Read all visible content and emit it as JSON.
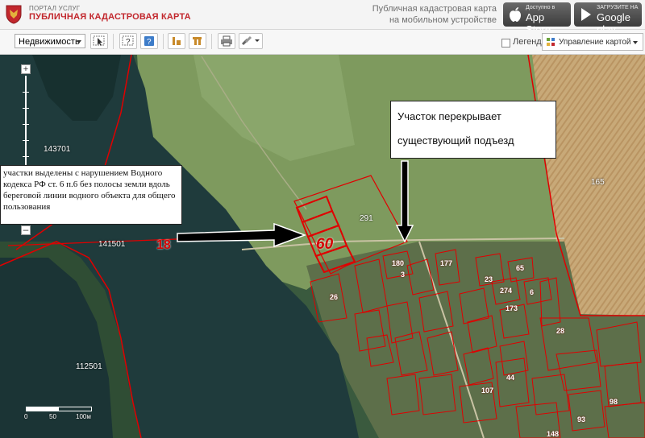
{
  "header": {
    "portal_small": "ПОРТАЛ УСЛУГ",
    "portal_title": "ПУБЛИЧНАЯ КАДАСТРОВАЯ КАРТА",
    "mobile_line1": "Публичная кадастровая карта",
    "mobile_line2": "на мобильном устройстве",
    "appstore_small": "Доступно в",
    "appstore_big": "App Store",
    "googleplay_small": "ЗАГРУЗИТЕ НА",
    "googleplay_big": "Google play"
  },
  "toolbar": {
    "layer_select": "Недвижимость",
    "legend_label": "Легенда",
    "map_control_label": "Управление картой"
  },
  "map": {
    "labels": {
      "l143701": "143701",
      "l141501": "141501",
      "l112501": "112501",
      "l165": "165",
      "l291": "291",
      "l180": "180",
      "l3": "3",
      "l177": "177",
      "l65": "65",
      "l23": "23",
      "l274": "274",
      "l6": "6",
      "l26": "26",
      "l28": "28",
      "l44": "44",
      "l93": "93",
      "l98": "98",
      "l148": "148",
      "l173": "173",
      "l107": "107"
    },
    "num18": "18",
    "num60": "60",
    "scale": {
      "zero": "0",
      "fifty": "50",
      "hundred": "100м"
    }
  },
  "callouts": {
    "left_text": "участки выделены с нарушением Водного кодекса РФ ст. 6 п.6 без полосы земли вдоль береговой линии водного объекта для общего пользования",
    "right_line1": "Участок перекрывает",
    "right_line2": "существующий подъезд"
  },
  "colors": {
    "accent_red": "#c2272d",
    "boundary_red": "#e00000"
  }
}
